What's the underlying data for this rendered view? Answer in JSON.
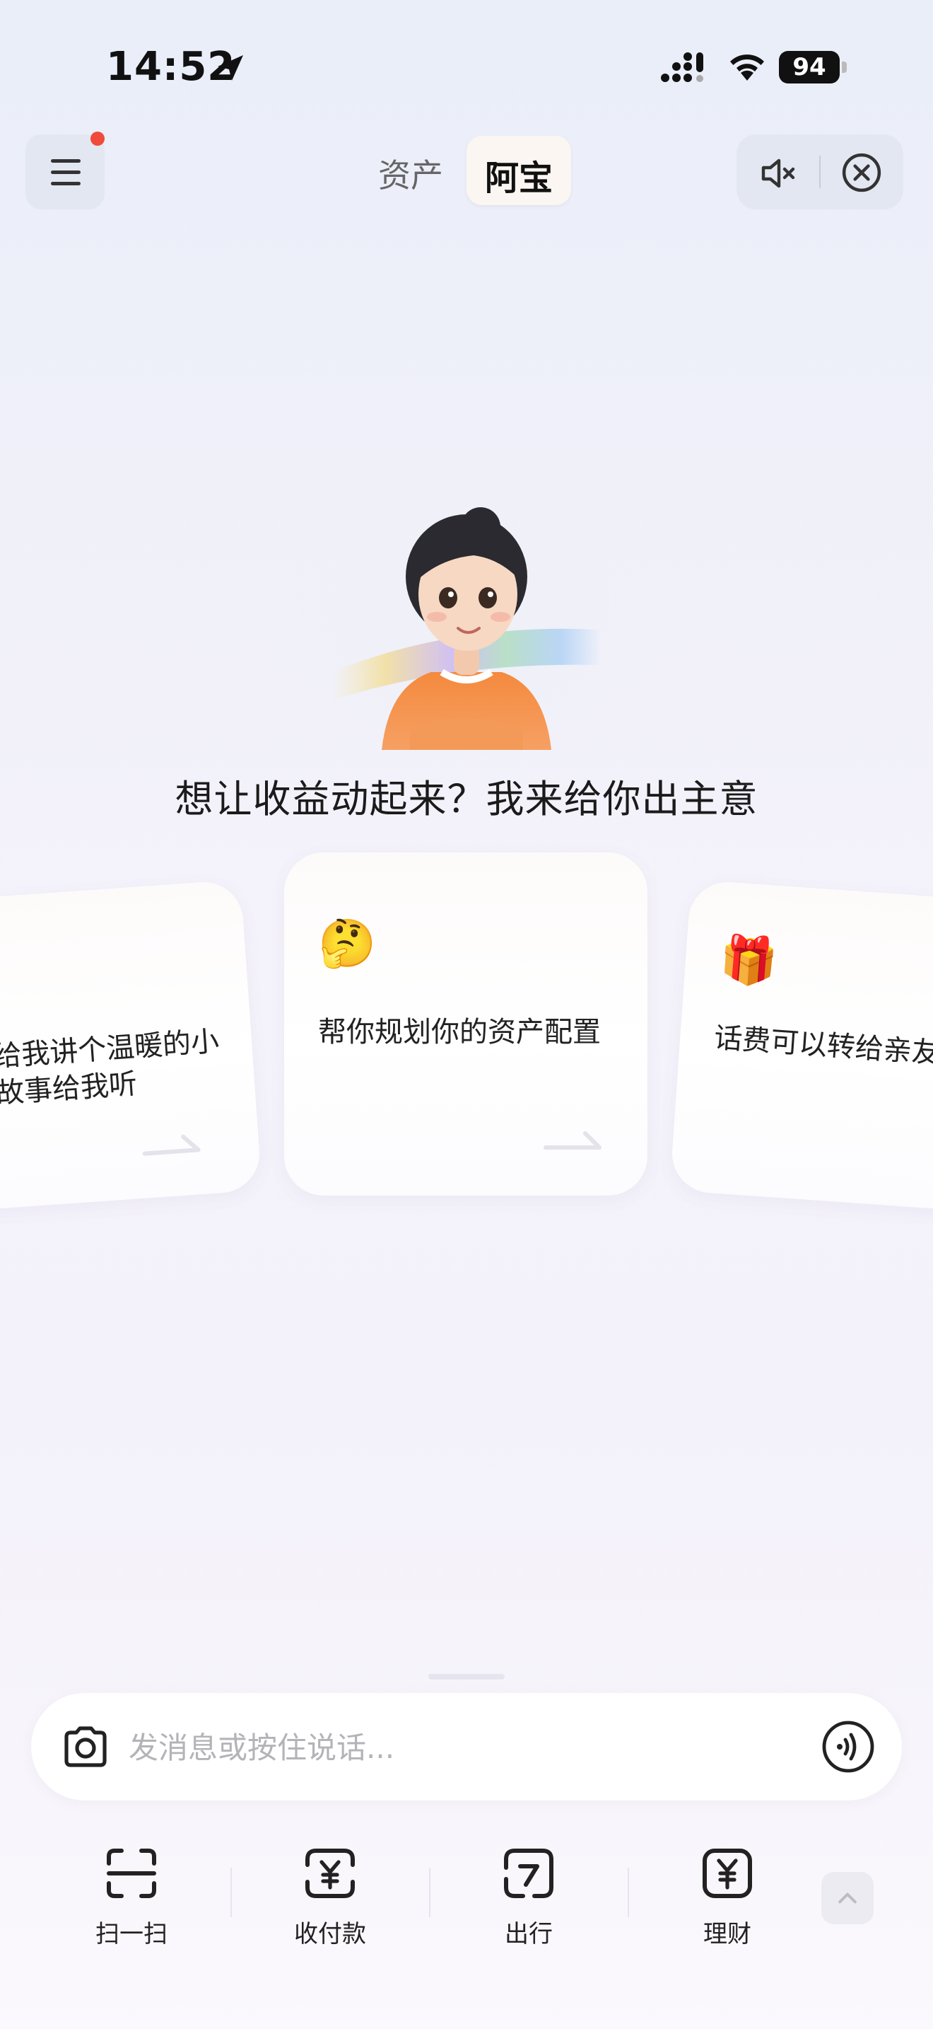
{
  "status_bar": {
    "time": "14:52",
    "battery": "94"
  },
  "header": {
    "tabs": [
      {
        "label": "资产",
        "active": false
      },
      {
        "label": "阿宝",
        "active": true
      }
    ]
  },
  "main": {
    "headline": "想让收益动起来？我来给你出主意",
    "cards": [
      {
        "emoji": "",
        "text": "给我讲个温暖的小故事给我听"
      },
      {
        "emoji": "🤔",
        "text": "帮你规划你的资产配置"
      },
      {
        "emoji": "🎁",
        "text": "话费可以转给亲友吗?"
      }
    ]
  },
  "input": {
    "placeholder": "发消息或按住说话..."
  },
  "bottom_nav": {
    "items": [
      {
        "label": "扫一扫",
        "icon": "scan-icon"
      },
      {
        "label": "收付款",
        "icon": "payment-icon"
      },
      {
        "label": "出行",
        "icon": "travel-icon"
      },
      {
        "label": "理财",
        "icon": "wealth-icon"
      }
    ]
  },
  "colors": {
    "notification_dot": "#f04a3a",
    "active_tab_bg": "#fbf6f1"
  }
}
